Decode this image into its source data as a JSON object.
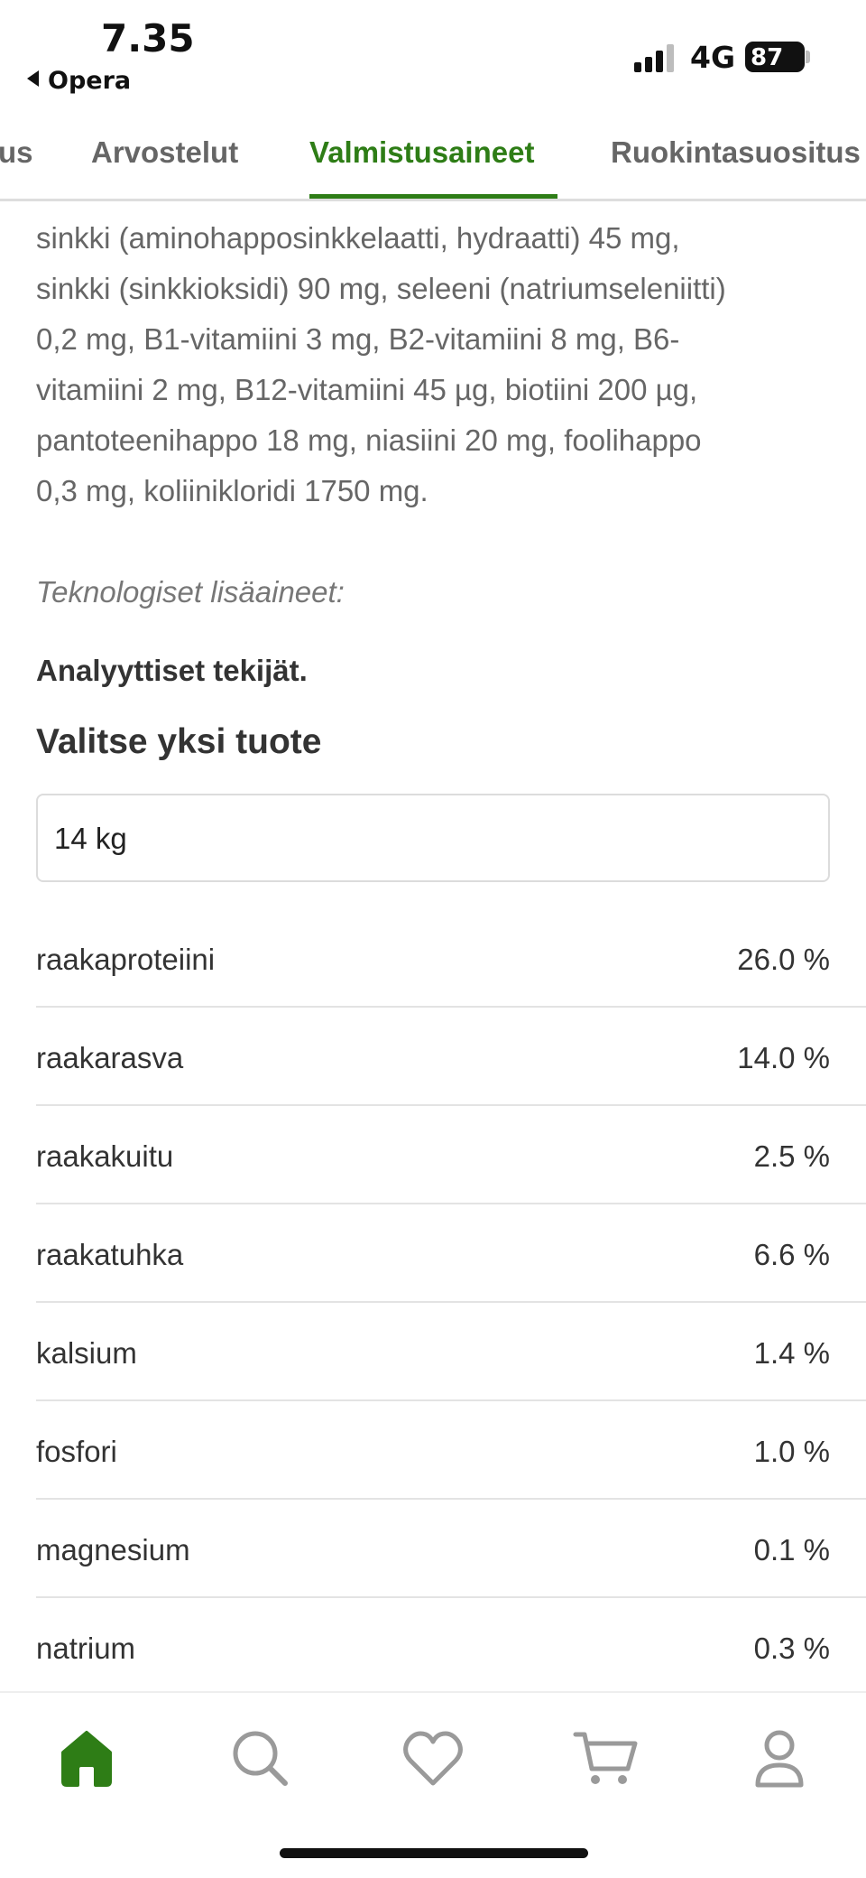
{
  "status_bar": {
    "time": "7.35",
    "back_app": "Opera",
    "network": "4G",
    "battery": "87"
  },
  "tabs": [
    {
      "label": "us"
    },
    {
      "label": "Arvostelut"
    },
    {
      "label": "Valmistusaineet",
      "active": true
    },
    {
      "label": "Ruokintasuositus"
    }
  ],
  "ingredients": {
    "lines": [
      "sinkki (aminohapposinkkelaatti, hydraatti) 45 mg,",
      "sinkki (sinkkioksidi) 90 mg, seleeni (natriumseleniitti)",
      "0,2 mg, B1-vitamiini 3 mg, B2-vitamiini 8 mg, B6-",
      "vitamiini 2 mg, B12-vitamiini 45 µg, biotiini 200 µg,",
      "pantoteenihappo 18 mg, niasiini 20 mg, foolihappo",
      "0,3 mg, koliinikloridi 1750 mg."
    ],
    "technological_additives": "Teknologiset lisäaineet:",
    "analytical_heading": "Analyyttiset tekijät."
  },
  "product_select": {
    "heading": "Valitse yksi tuote",
    "selected": "14 kg"
  },
  "analysis": [
    {
      "name": "raakaproteiini",
      "value": "26.0 %"
    },
    {
      "name": "raakarasva",
      "value": "14.0 %"
    },
    {
      "name": "raakakuitu",
      "value": "2.5 %"
    },
    {
      "name": "raakatuhka",
      "value": "6.6 %"
    },
    {
      "name": "kalsium",
      "value": "1.4 %"
    },
    {
      "name": "fosfori",
      "value": "1.0 %"
    },
    {
      "name": "magnesium",
      "value": "0.1 %"
    },
    {
      "name": "natrium",
      "value": "0.3 %"
    }
  ],
  "bottom_nav": [
    {
      "icon": "home-icon",
      "active": true
    },
    {
      "icon": "search-icon"
    },
    {
      "icon": "heart-icon"
    },
    {
      "icon": "cart-icon"
    },
    {
      "icon": "user-icon"
    }
  ],
  "colors": {
    "accent": "#2e7d16",
    "text": "#333333",
    "muted": "#666666",
    "icon_gray": "#9a9a9a"
  }
}
